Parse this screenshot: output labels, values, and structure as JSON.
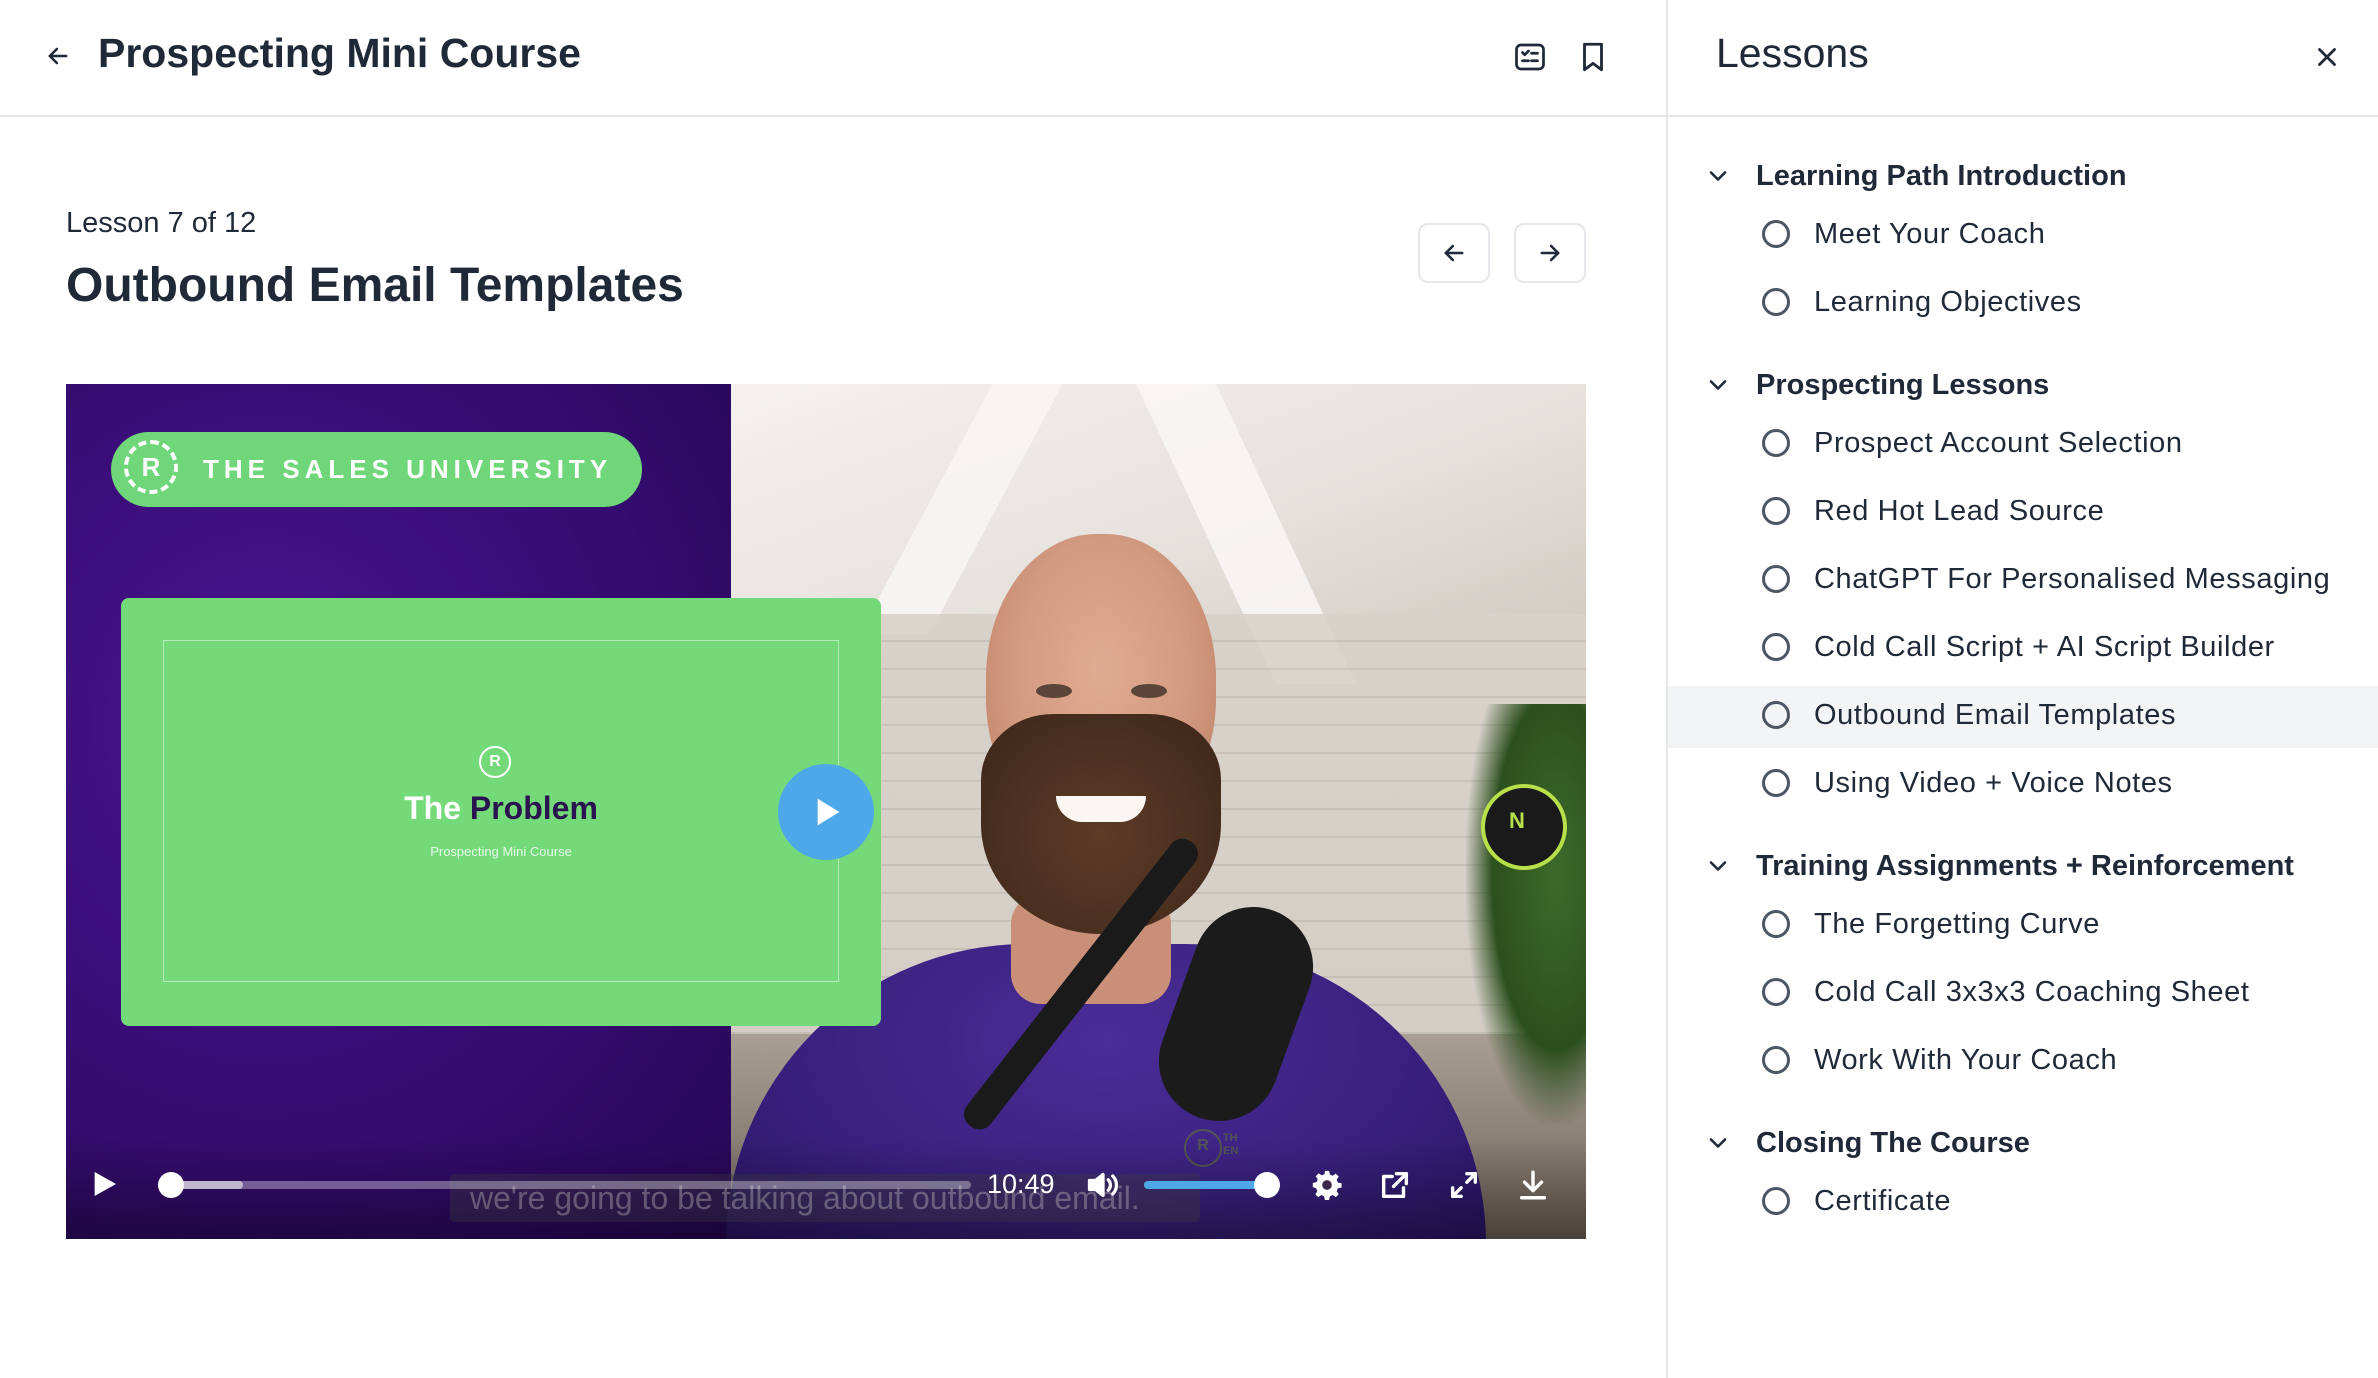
{
  "header": {
    "course_title": "Prospecting Mini Course"
  },
  "lesson": {
    "count_label": "Lesson 7 of 12",
    "title": "Outbound Email Templates"
  },
  "video": {
    "brand_text": "THE SALES UNIVERSITY",
    "brand_logo_letter": "R",
    "slide_title_prefix": "The",
    "slide_title_emphasis": "Problem",
    "slide_subtitle": "Prospecting Mini Course",
    "caption": "we're going to be talking about outbound email.",
    "time": "10:49",
    "progress_fraction": 0.09,
    "volume_fraction": 1.0,
    "mic_badge_letter": "N",
    "watermark_text": "TH\nEN"
  },
  "side_panel": {
    "title": "Lessons",
    "sections": [
      {
        "label": "Learning Path Introduction",
        "lessons": [
          "Meet Your Coach",
          "Learning Objectives"
        ]
      },
      {
        "label": "Prospecting Lessons",
        "lessons": [
          "Prospect Account Selection",
          "Red Hot Lead Source",
          "ChatGPT For Personalised Messaging",
          "Cold Call Script + AI Script Builder",
          "Outbound Email Templates",
          "Using Video + Voice Notes"
        ]
      },
      {
        "label": "Training Assignments + Reinforcement",
        "lessons": [
          "The Forgetting Curve",
          "Cold Call 3x3x3 Coaching Sheet",
          "Work With Your Coach"
        ]
      },
      {
        "label": "Closing The Course",
        "lessons": [
          "Certificate"
        ]
      }
    ],
    "active_lesson": "Outbound Email Templates"
  },
  "icons": {
    "back": "arrow-left-icon",
    "checklist": "checklist-icon",
    "bookmark": "bookmark-icon",
    "close": "close-icon",
    "prev": "arrow-left-icon",
    "next": "arrow-right-icon",
    "chevron": "chevron-down-icon",
    "lesson_status": "circle-outline-icon"
  },
  "colors": {
    "accent_green": "#6fd67a",
    "video_purple": "#3a0d78",
    "play_blue": "#4ea8e8",
    "active_row": "#f3f4f6"
  }
}
